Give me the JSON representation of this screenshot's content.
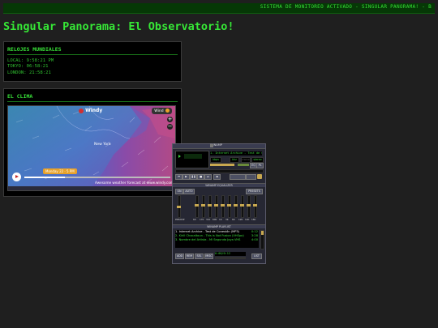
{
  "ticker": "SISTEMA DE MONITOREO ACTIVADO - SINGULAR PANORAMA! - B",
  "page_title": "Singular Panorama: El Observatorio!",
  "clocks": {
    "heading": "RELOJES MUNDIALES",
    "lines": [
      "LOCAL: 9:58:21 PM",
      "TOKYO: 06:58:21",
      "LONDON: 21:58:21"
    ]
  },
  "weather": {
    "heading": "EL CLIMA",
    "map_brand": "Windy",
    "menu_label": "Wind",
    "city_label": "New York",
    "time_badge": "Monday 22 · 5 PM",
    "footer_text": "Awesome weather forecast at www.windy.com"
  },
  "winamp": {
    "title": "WINAMP",
    "track_info": "1. Internet Archive - Test de Conexión (MP3)",
    "kbps_label": "kbps",
    "khz_label": "khz",
    "mono_label": "mono",
    "stereo_label": "stereo",
    "eq_button": "EQ",
    "pl_button": "PL",
    "eq_title": "WINAMP EQUALIZER",
    "eq_on": "ON",
    "eq_auto": "AUTO",
    "eq_presets": "PRESETS",
    "eq_band_labels": [
      "PREAMP",
      "60",
      "170",
      "310",
      "600",
      "1K",
      "3K",
      "6K",
      "12K",
      "14K",
      "16K"
    ],
    "pl_title": "WINAMP PLAYLIST",
    "playlist": [
      {
        "title": "1. Internet Archive - Test de Conexión (MP3)",
        "duration": "0:12"
      },
      {
        "title": "2. Kirill Chacaltoun - This is Not Fusion (VHSpo)",
        "duration": "3:28"
      },
      {
        "title": "3. Nombre del Artista - Mi Segunda Joya VHS",
        "duration": "4:00"
      }
    ],
    "pl_buttons": [
      "ADD",
      "REM",
      "SEL",
      "MISC",
      "LIST"
    ],
    "pl_time": "0:00/0:12"
  },
  "colors": {
    "accent": "#2cd02c",
    "background": "#1f1f1f"
  }
}
